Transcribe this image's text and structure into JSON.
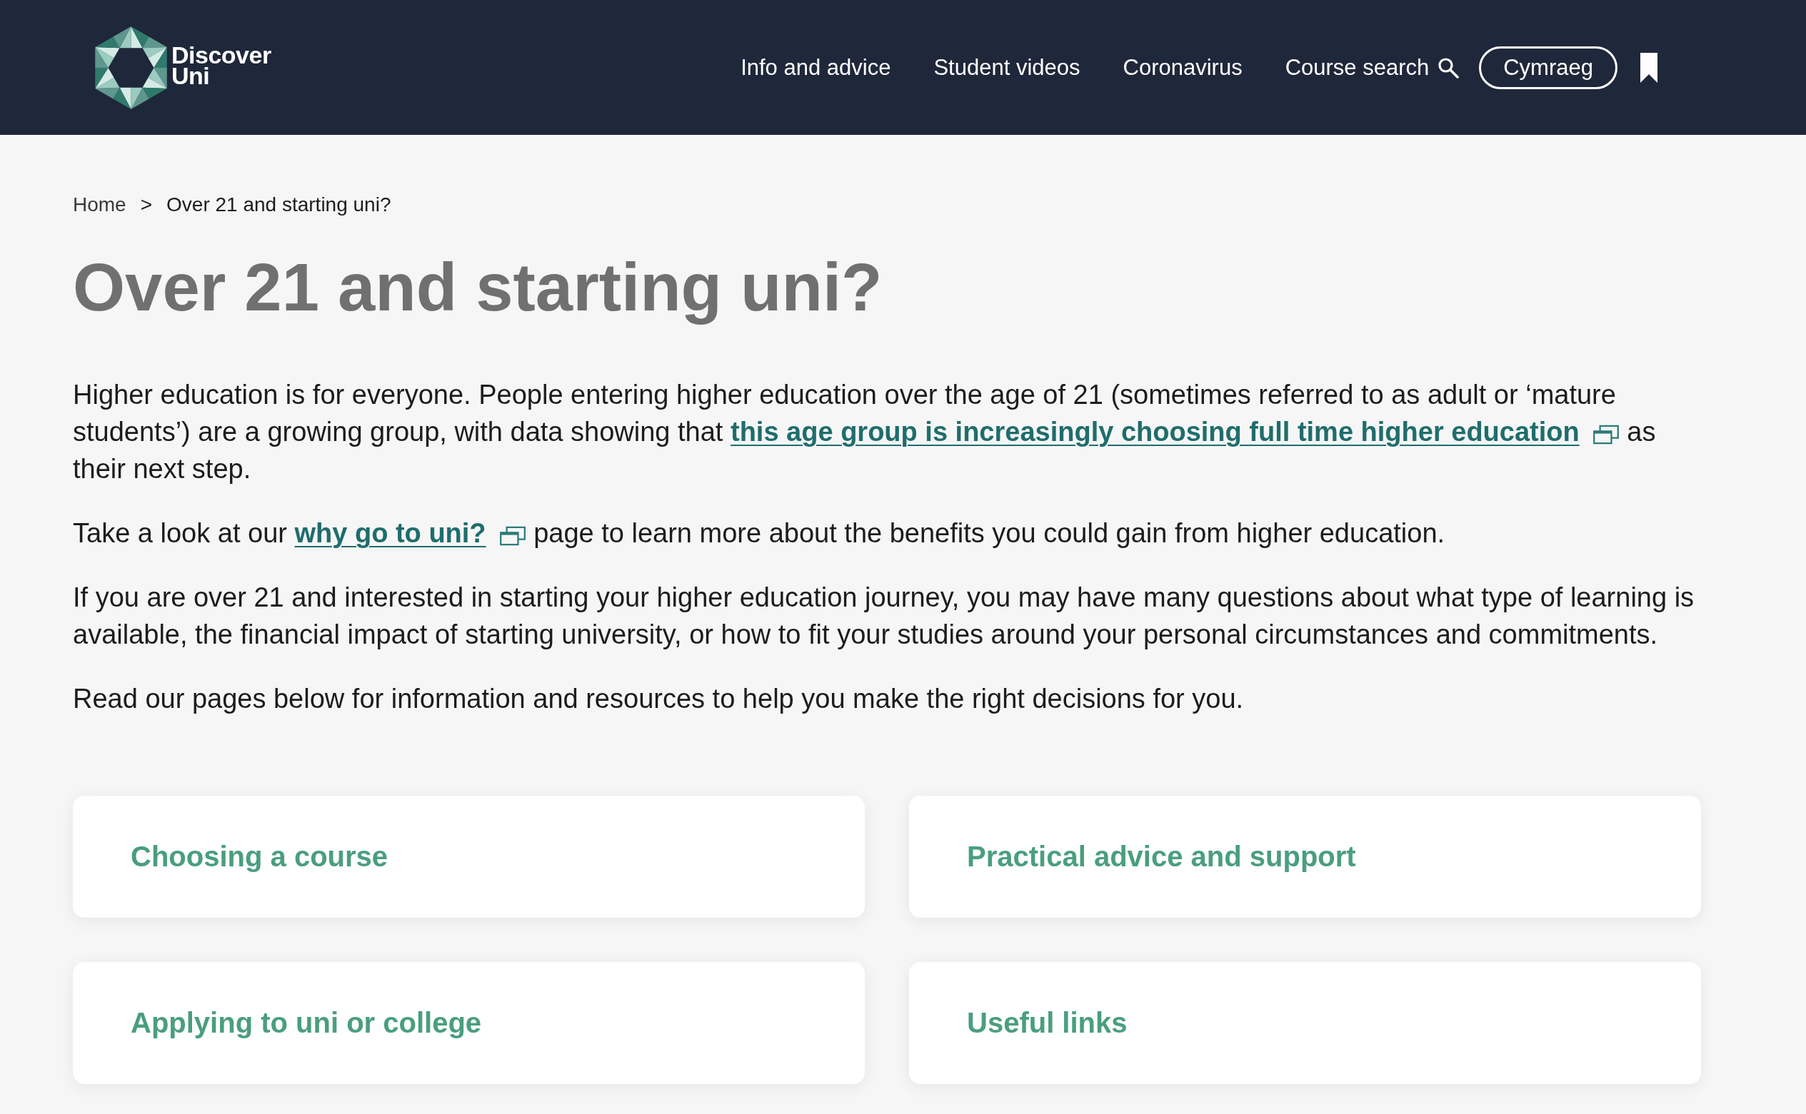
{
  "header": {
    "logo": "Discover Uni",
    "nav": [
      {
        "label": "Info and advice",
        "kind": "link"
      },
      {
        "label": "Student videos",
        "kind": "link"
      },
      {
        "label": "Coronavirus",
        "kind": "link"
      },
      {
        "label": "Course search",
        "kind": "search"
      },
      {
        "label": "Cymraeg",
        "kind": "language"
      }
    ]
  },
  "breadcrumb": [
    {
      "label": "Home",
      "kind": "link"
    },
    {
      "label": ">",
      "kind": "separator"
    },
    {
      "label": "Over 21 and starting uni?",
      "kind": "current"
    }
  ],
  "title": "Over 21 and starting uni?",
  "paragraphs": [
    {
      "parts": [
        {
          "kind": "text",
          "text": "Higher education is for everyone. People entering higher education over the age of 21 (sometimes referred to as adult or ‘mature students’) are a growing group, with data showing that "
        },
        {
          "kind": "external-link",
          "text": "this age group is increasingly choosing full time higher education"
        },
        {
          "kind": "text",
          "text": " as their next step."
        }
      ]
    },
    {
      "parts": [
        {
          "kind": "text",
          "text": "Take a look at our "
        },
        {
          "kind": "external-link",
          "text": "why go to uni?"
        },
        {
          "kind": "text",
          "text": " page to learn more about the benefits you could gain from higher education."
        }
      ]
    },
    {
      "parts": [
        {
          "kind": "text",
          "text": "If you are over 21 and interested in starting your higher education journey, you may have many questions about what type of learning is available, the financial impact of starting university, or how to fit your studies around your personal circumstances and commitments."
        }
      ]
    },
    {
      "parts": [
        {
          "kind": "text",
          "text": "Read our pages below for information and resources to help you make the right decisions for you."
        }
      ]
    }
  ],
  "cards": [
    {
      "label": "Choosing a course"
    },
    {
      "label": "Practical advice and support"
    },
    {
      "label": "Applying to uni or college"
    },
    {
      "label": "Useful links"
    }
  ]
}
